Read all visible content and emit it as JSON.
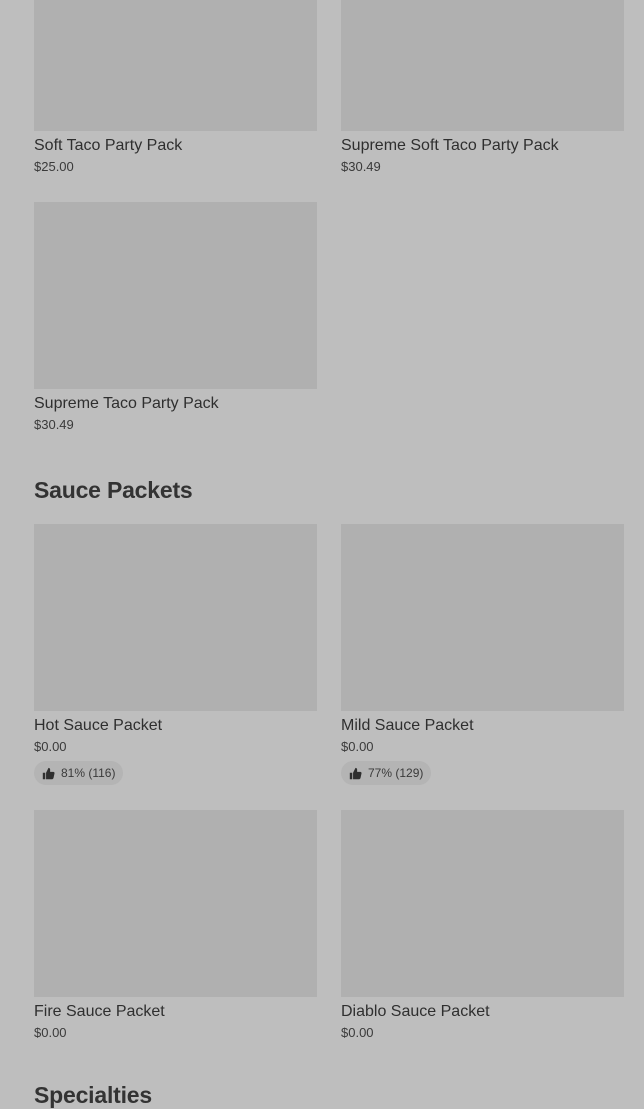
{
  "sections": [
    {
      "title": "",
      "items": [
        {
          "name": "Soft Taco Party Pack",
          "price": "$25.00"
        },
        {
          "name": "Supreme Soft Taco Party Pack",
          "price": "$30.49"
        },
        {
          "name": "Supreme Taco Party Pack",
          "price": "$30.49"
        }
      ]
    },
    {
      "title": "Sauce Packets",
      "items": [
        {
          "name": "Hot Sauce Packet",
          "price": "$0.00",
          "rating": "81% (116)",
          "rating_icon": "thumbs-up-icon"
        },
        {
          "name": "Mild Sauce Packet",
          "price": "$0.00",
          "rating": "77% (129)",
          "rating_icon": "thumbs-up-icon"
        },
        {
          "name": "Fire Sauce Packet",
          "price": "$0.00"
        },
        {
          "name": "Diablo Sauce Packet",
          "price": "$0.00"
        }
      ]
    },
    {
      "title": "Specialties",
      "items": []
    }
  ],
  "colors": {
    "background": "#bebebe",
    "thumbnail": "#b0b0b0",
    "rating_pill": "#b4b4b4",
    "text": "#2f2f2f"
  }
}
